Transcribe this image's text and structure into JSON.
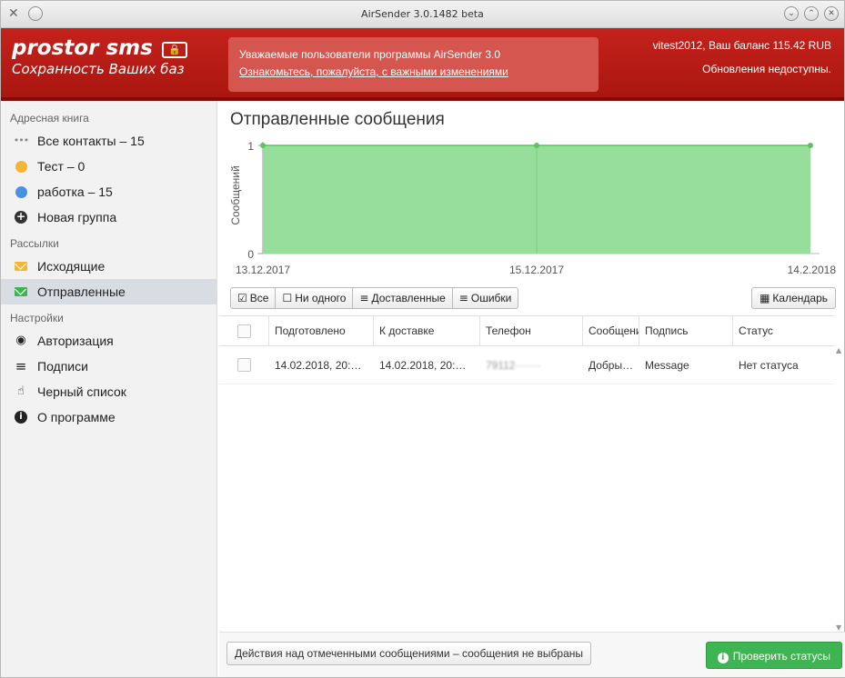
{
  "window": {
    "title": "AirSender 3.0.1482 beta",
    "app_icon": "✕",
    "btn_menu": "⌄",
    "btn_min": "⌄",
    "btn_max": "⌃",
    "btn_close": "✕"
  },
  "header": {
    "logo_title": "prostor sms",
    "logo_sub": "Сохранность Ваших баз",
    "notice_line1": "Уважаемые пользователи программы AirSender 3.0",
    "notice_line2": "Ознакомьтесь, пожалуйста, с важными изменениями",
    "account": "vitest2012, Ваш баланс 115.42 RUB",
    "updates": "Обновления недоступны."
  },
  "sidebar": {
    "address_book_title": "Адресная книга",
    "contacts": [
      {
        "label": "Все контакты – 15",
        "icon": "dots-icon",
        "color": "#888888"
      },
      {
        "label": "Тест – 0",
        "icon": "dot-icon",
        "color": "#f5b731"
      },
      {
        "label": "работка – 15",
        "icon": "dot-icon",
        "color": "#4a90e2"
      },
      {
        "label": "Новая группа",
        "icon": "plus-circle-icon",
        "color": "#333333"
      }
    ],
    "mailings_title": "Рассылки",
    "mailings": [
      {
        "label": "Исходящие",
        "icon": "envelope-icon",
        "color": "#f5b731"
      },
      {
        "label": "Отправленные",
        "icon": "envelope-icon",
        "color": "#3fb452"
      }
    ],
    "settings_title": "Настройки",
    "settings": [
      {
        "label": "Авторизация",
        "icon": "user-circle-icon"
      },
      {
        "label": "Подписи",
        "icon": "list-icon"
      },
      {
        "label": "Черный список",
        "icon": "hand-icon"
      },
      {
        "label": "О программе",
        "icon": "info-icon"
      }
    ]
  },
  "main": {
    "title": "Отправленные сообщения"
  },
  "chart_data": {
    "type": "area",
    "x": [
      "13.12.2017",
      "15.12.2017",
      "14.2.2018"
    ],
    "values": [
      1,
      1,
      1
    ],
    "ylabel": "Сообщений",
    "yticks": [
      "0",
      "1"
    ],
    "ylim": [
      0,
      1
    ],
    "fill_color": "#97dd9b",
    "line_color": "#5fc35f"
  },
  "filters": {
    "all": "Все",
    "none": "Ни одного",
    "delivered": "Доставленные",
    "errors": "Ошибки",
    "calendar": "Календарь"
  },
  "table": {
    "columns": [
      "Подготовлено",
      "К доставке",
      "Телефон",
      "Сообщение",
      "Подпись",
      "Статус"
    ],
    "rows": [
      {
        "prepared": "14.02.2018, 20:…",
        "delivery": "14.02.2018, 20:…",
        "phone": "79112·······",
        "message": "Добры…",
        "signature": "Message",
        "status": "Нет статуса"
      }
    ]
  },
  "footer": {
    "actions": "Действия над отмеченными сообщениями – сообщения не выбраны",
    "check_status": "Проверить статусы"
  }
}
